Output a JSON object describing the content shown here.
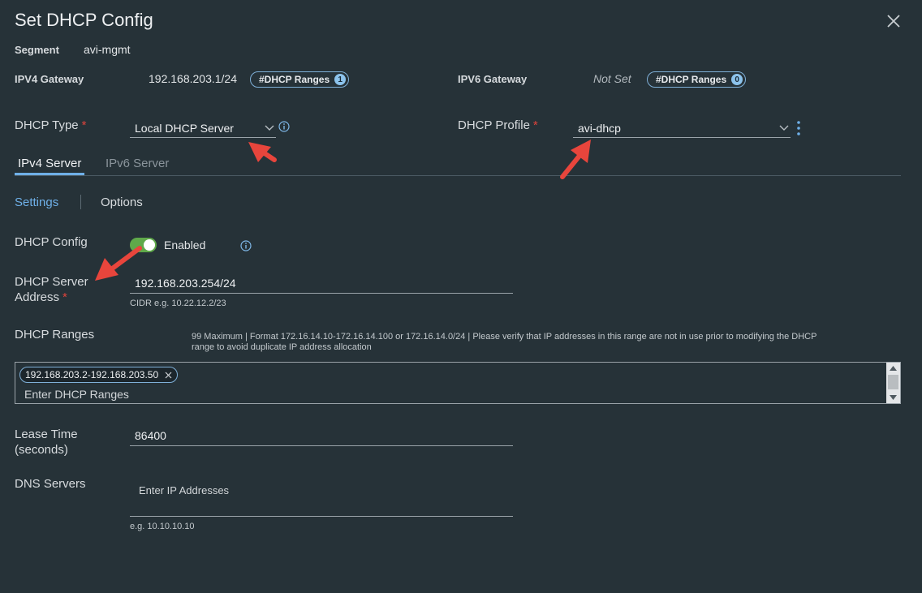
{
  "dialog": {
    "title": "Set DHCP Config"
  },
  "segment": {
    "label": "Segment",
    "value": "avi-mgmt"
  },
  "ipv4_gateway": {
    "label": "IPV4 Gateway",
    "value": "192.168.203.1/24",
    "pill_label": "#DHCP Ranges",
    "pill_count": "1"
  },
  "ipv6_gateway": {
    "label": "IPV6 Gateway",
    "value": "Not Set",
    "pill_label": "#DHCP Ranges",
    "pill_count": "0"
  },
  "dhcp_type": {
    "label": "DHCP Type",
    "required": "*",
    "value": "Local DHCP Server"
  },
  "dhcp_profile": {
    "label": "DHCP Profile",
    "required": "*",
    "value": "avi-dhcp"
  },
  "tabs": [
    {
      "label": "IPv4 Server",
      "active": true
    },
    {
      "label": "IPv6 Server",
      "active": false
    }
  ],
  "subtabs": {
    "settings": "Settings",
    "options": "Options"
  },
  "dhcp_config": {
    "label": "DHCP Config",
    "toggle_state": "Enabled"
  },
  "server_address": {
    "label_line1": "DHCP Server",
    "label_line2": "Address",
    "required": "*",
    "value": "192.168.203.254/24",
    "hint": "CIDR e.g. 10.22.12.2/23"
  },
  "dhcp_ranges": {
    "label": "DHCP Ranges",
    "help_line1": "99 Maximum | Format 172.16.14.10-172.16.14.100 or 172.16.14.0/24 | Please verify that IP addresses in this range are not in use prior to modifying the DHCP",
    "help_line2": "range to avoid duplicate IP address allocation",
    "chips": [
      "192.168.203.2-192.168.203.50"
    ],
    "placeholder": "Enter DHCP Ranges"
  },
  "lease_time": {
    "label_line1": "Lease Time",
    "label_line2": "(seconds)",
    "value": "86400"
  },
  "dns_servers": {
    "label": "DNS Servers",
    "placeholder": "Enter IP Addresses",
    "hint": "e.g. 10.10.10.10"
  },
  "colors": {
    "background": "#263238",
    "accent": "#6fb0e8",
    "toggle_on": "#5fa94a",
    "required": "#e0443c",
    "annotation_arrow": "#e8453c"
  }
}
